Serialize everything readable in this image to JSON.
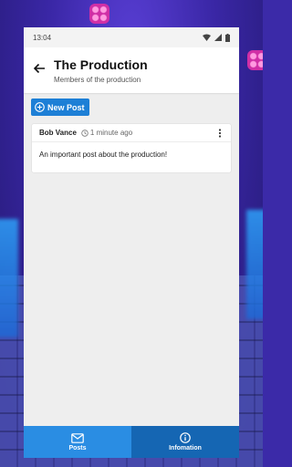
{
  "status": {
    "time": "13:04"
  },
  "header": {
    "title": "The Production",
    "subtitle": "Members of the production"
  },
  "actions": {
    "new_post_label": "New Post"
  },
  "posts": [
    {
      "author": "Bob Vance",
      "time": "1 minute ago",
      "content": "An important post about the production!"
    }
  ],
  "nav": {
    "tabs": [
      {
        "label": "Posts"
      },
      {
        "label": "Infomation"
      }
    ]
  },
  "colors": {
    "accent": "#1d7fd6",
    "appbar": "#ffffff",
    "background": "#eeeeee"
  }
}
